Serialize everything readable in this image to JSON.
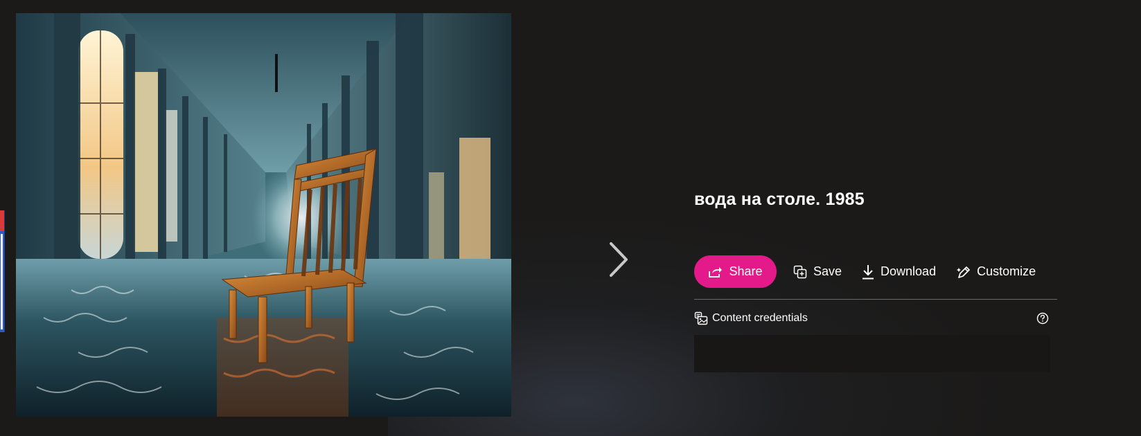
{
  "viewer": {
    "title": "вода на столе. 1985",
    "actions": {
      "share_label": "Share",
      "save_label": "Save",
      "download_label": "Download",
      "customize_label": "Customize"
    },
    "credentials": {
      "label": "Content credentials"
    },
    "icons": {
      "next": "chevron-right-icon",
      "share": "share-arrow-icon",
      "save": "add-to-collection-icon",
      "download": "download-icon",
      "customize": "pen-sparkle-icon",
      "credentials": "content-credentials-icon",
      "help": "question-circle-icon"
    }
  },
  "image": {
    "alt": "A wooden chair standing in water in a long flooded hallway lit by sunlight through tall windows"
  },
  "colors": {
    "page_background": "#1b1a19",
    "share_accent": "#e41a8a",
    "text": "#ffffff",
    "divider": "#6b6a69"
  }
}
